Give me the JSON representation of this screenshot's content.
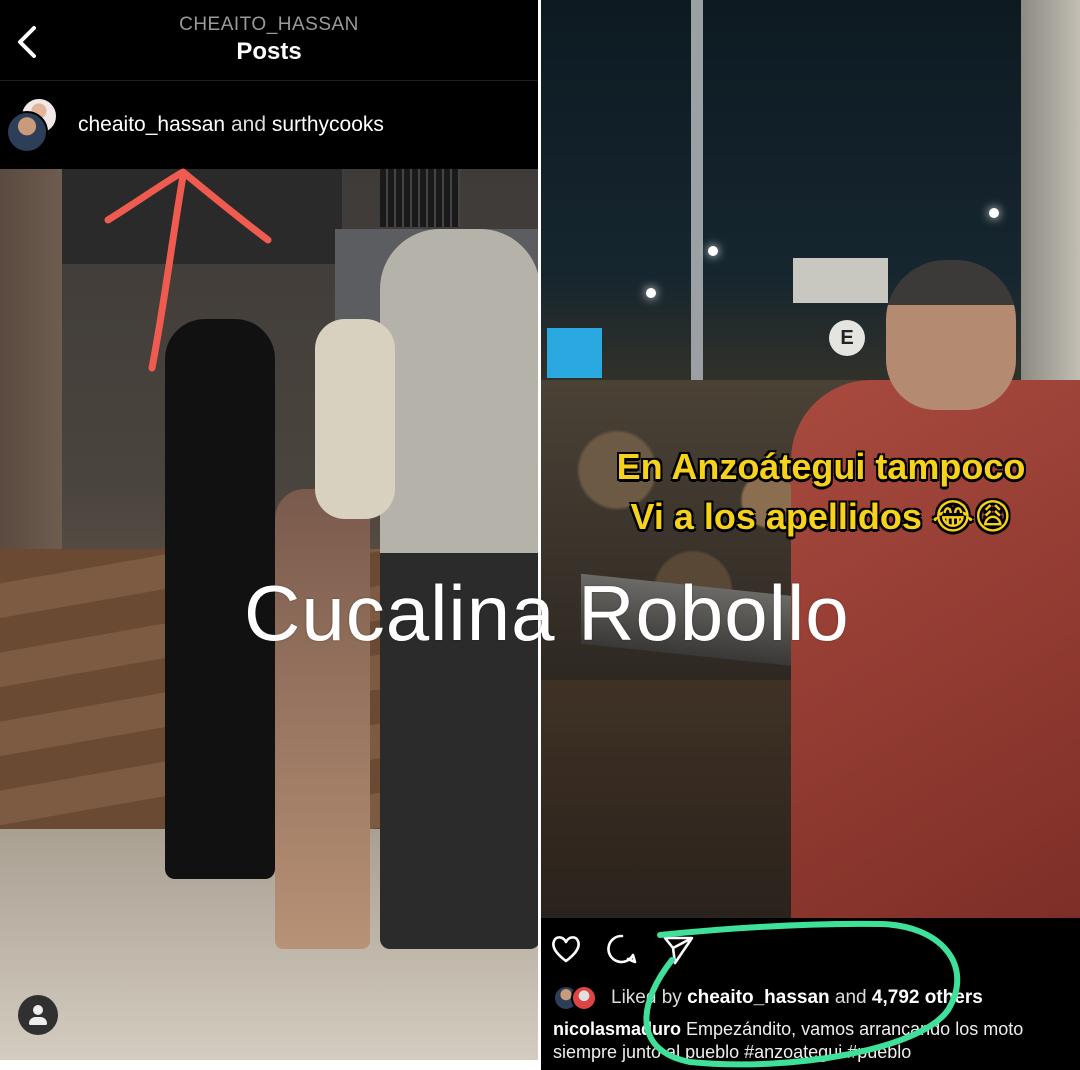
{
  "left_post": {
    "header_username": "CHEAITO_HASSAN",
    "header_title": "Posts",
    "collab_user1": "cheaito_hassan",
    "collab_joiner": "and",
    "collab_user2": "surthycooks"
  },
  "right_post": {
    "video_overlay_line1": "En Anzoátegui tampoco",
    "video_overlay_line2": "Vi a los apellidos 😂😩",
    "sign_letter": "E",
    "liked_prefix": "Liked by",
    "liked_user": "cheaito_hassan",
    "liked_and": "and",
    "liked_count": "4,792 others",
    "caption_user": "nicolasmaduro",
    "caption_text": "Empezándito, vamos arrancando los moto",
    "caption_line2": "siempre junto al pueblo #anzoategui #pueblo"
  },
  "watermark": "Cucalina Robollo",
  "icons": {
    "back": "chevron-left-icon",
    "profile": "user-icon",
    "like": "heart-icon",
    "comment": "comment-icon",
    "share": "send-icon"
  },
  "colors": {
    "annotation_arrow": "#ef5b4e",
    "annotation_circle": "#3ee09a",
    "overlay_text": "#f7d21a"
  }
}
